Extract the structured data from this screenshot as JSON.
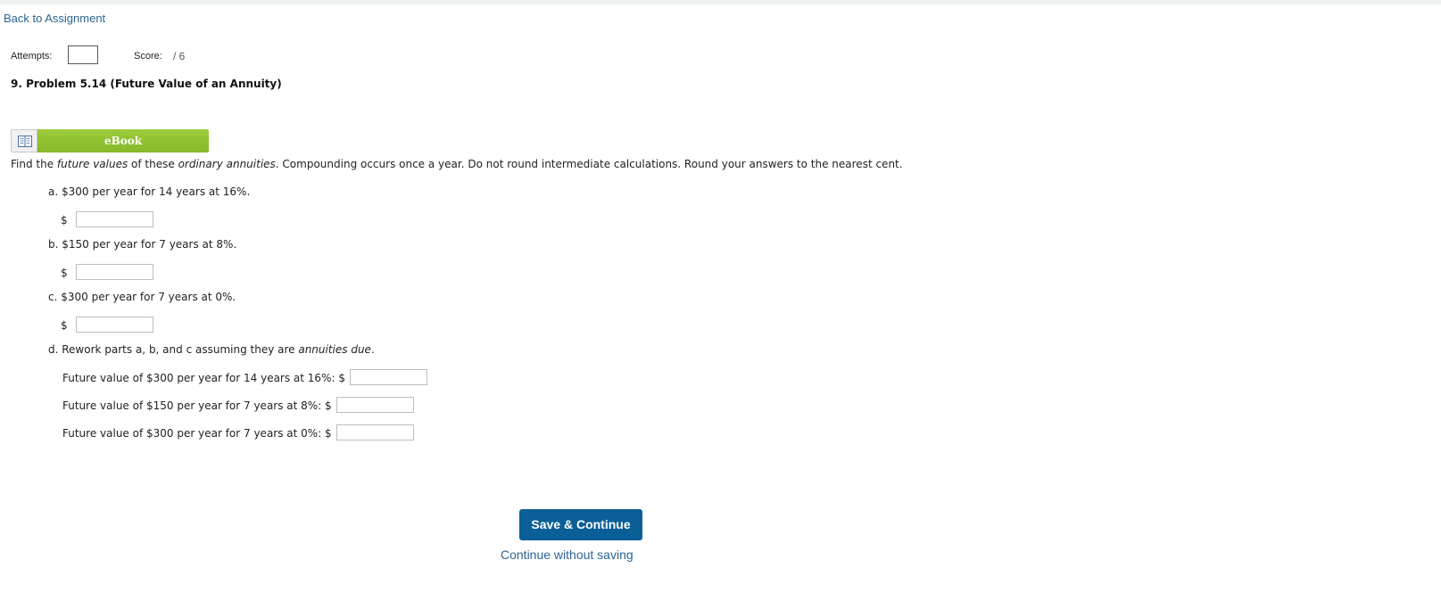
{
  "nav": {
    "back_label": "Back to Assignment"
  },
  "header": {
    "attempts_label": "Attempts:",
    "score_label": "Score:",
    "score_value": "/ 6"
  },
  "problem": {
    "title": "9. Problem 5.14 (Future Value of an Annuity)",
    "ebook_label": "eBook",
    "instructions": {
      "p1": "Find the ",
      "em1": "future values",
      "p2": " of these ",
      "em2": "ordinary annuities",
      "p3": ". Compounding occurs once a year. Do not round intermediate calculations. Round your answers to the nearest cent."
    },
    "parts": {
      "a": "a. $300 per year for 14 years at 16%.",
      "b": "b. $150 per year for 7 years at 8%.",
      "c": "c. $300 per year for 7 years at 0%.",
      "d_prefix": "d. Rework parts a, b, and c assuming they are ",
      "d_em": "annuities due",
      "d_suffix": "."
    },
    "currency_symbol": "$",
    "rework_rows": [
      {
        "label": "Future value of $300 per year for 14 years at 16%: $"
      },
      {
        "label": "Future value of $150 per year for 7 years at 8%: $"
      },
      {
        "label": "Future value of $300 per year for 7 years at 0%: $"
      }
    ]
  },
  "footer": {
    "save_label": "Save & Continue",
    "continue_label": "Continue without saving"
  },
  "colors": {
    "link": "#2a6496",
    "ebook_green": "#8dc034",
    "save_blue": "#0a5f98"
  }
}
